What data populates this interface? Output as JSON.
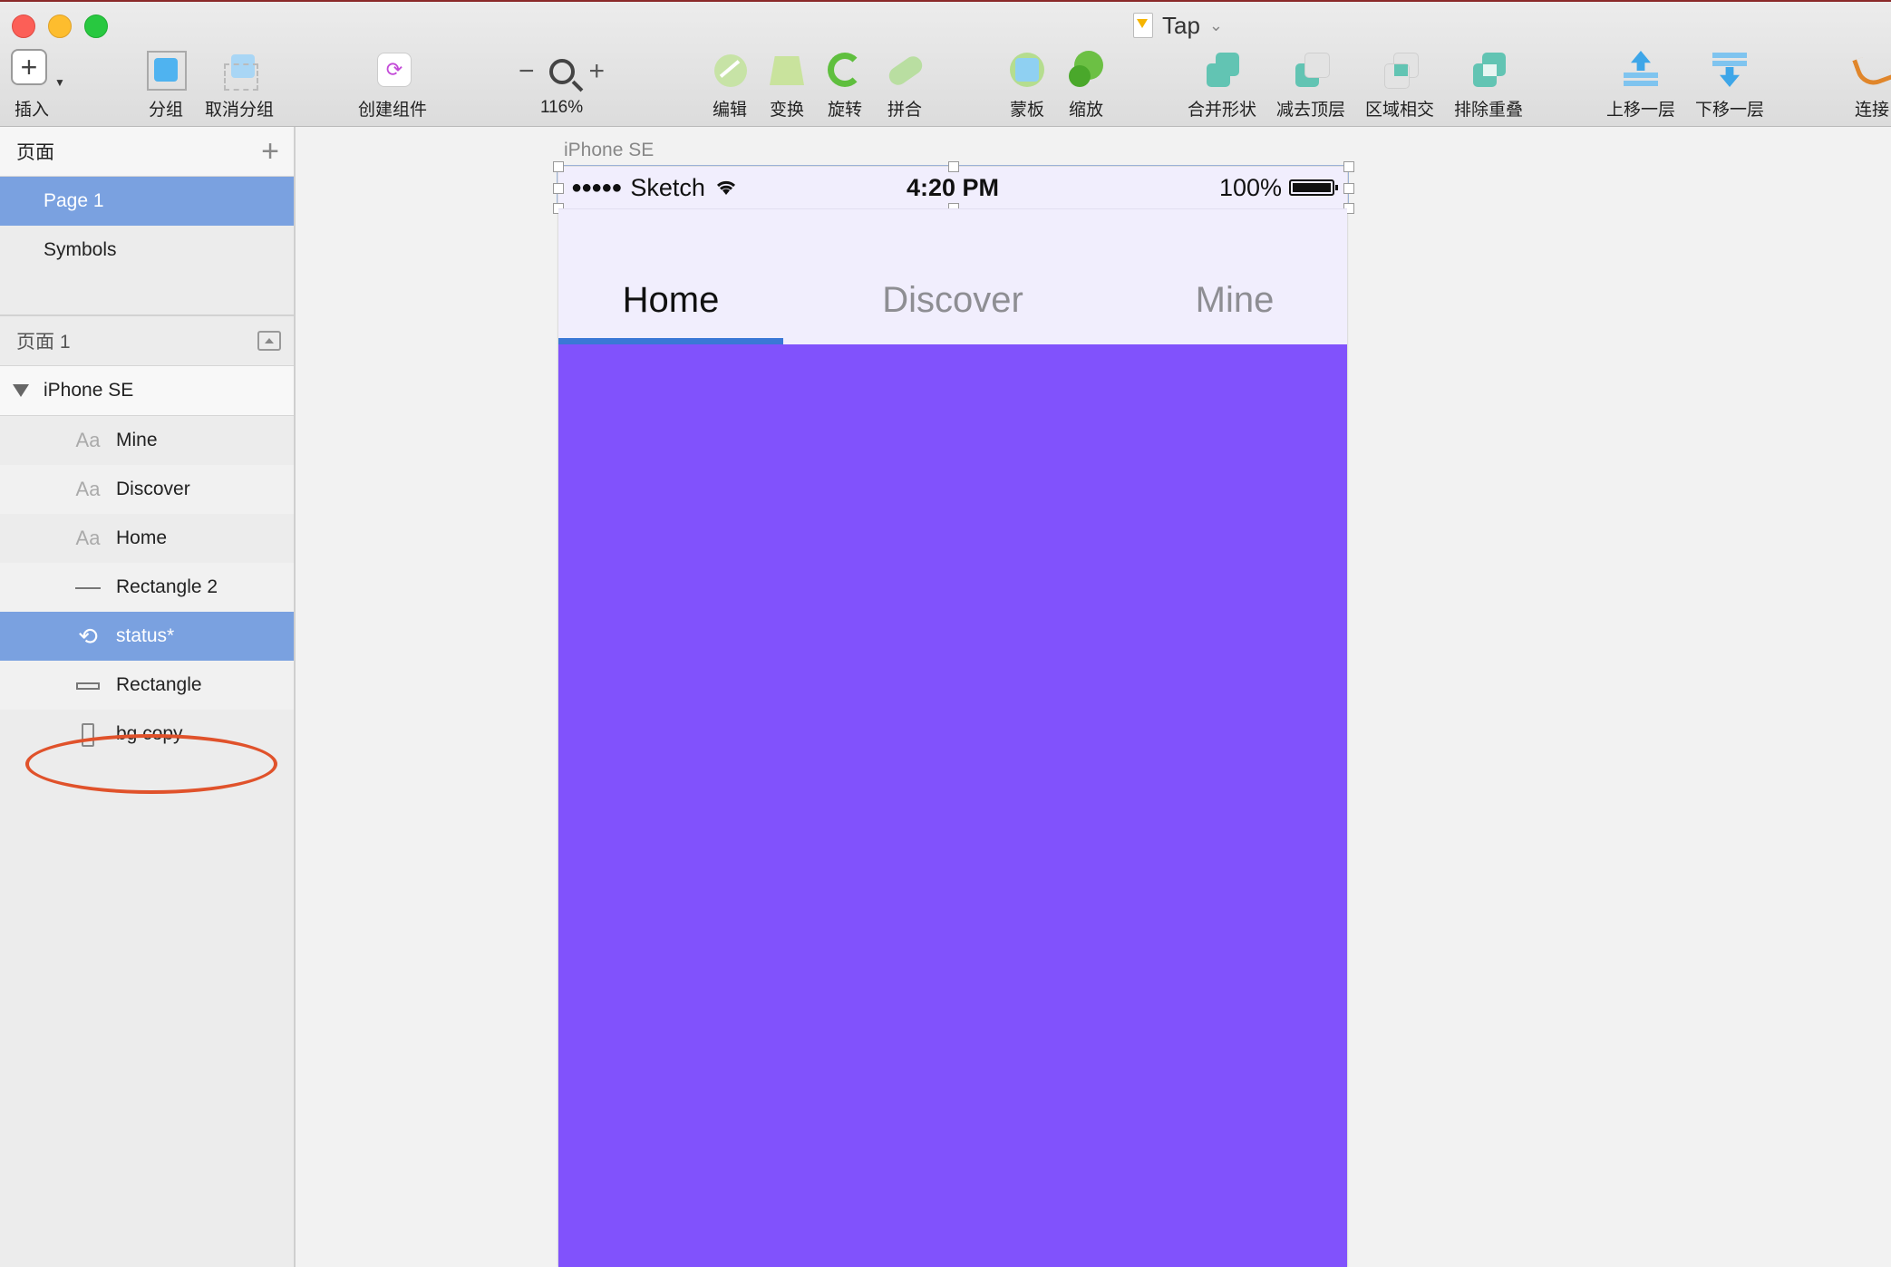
{
  "window": {
    "document_title": "Tap"
  },
  "toolbar": {
    "insert": "插入",
    "group": "分组",
    "ungroup": "取消分组",
    "create_symbol": "创建组件",
    "zoom_out": "−",
    "zoom_in": "+",
    "zoom_level": "116%",
    "edit": "编辑",
    "transform": "变换",
    "rotate": "旋转",
    "combine": "拼合",
    "mask": "蒙板",
    "scale": "缩放",
    "union": "合并形状",
    "subtract": "减去顶层",
    "intersect": "区域相交",
    "difference": "排除重叠",
    "forward": "上移一层",
    "backward": "下移一层",
    "link": "连接"
  },
  "sidebar": {
    "pages_title": "页面",
    "pages": [
      {
        "label": "Page 1",
        "selected": true
      },
      {
        "label": "Symbols",
        "selected": false
      }
    ],
    "layers_title": "页面 1",
    "artboard": "iPhone SE",
    "layers": [
      {
        "label": "Mine",
        "icon": "text-icon",
        "glyph": "Aa"
      },
      {
        "label": "Discover",
        "icon": "text-icon",
        "glyph": "Aa"
      },
      {
        "label": "Home",
        "icon": "text-icon",
        "glyph": "Aa"
      },
      {
        "label": "Rectangle 2",
        "icon": "line-icon"
      },
      {
        "label": "status*",
        "icon": "symbol-icon",
        "selected": true
      },
      {
        "label": "Rectangle",
        "icon": "rectangle-icon"
      },
      {
        "label": "bg copy",
        "icon": "artboard-icon"
      }
    ]
  },
  "canvas": {
    "artboard_label": "iPhone SE",
    "status_bar": {
      "signal": "●●●●●",
      "carrier": "Sketch",
      "time": "4:20 PM",
      "battery": "100%"
    },
    "tabs": [
      "Home",
      "Discover",
      "Mine"
    ],
    "active_tab": "Home",
    "colors": {
      "content": "#8152fc",
      "nav_background": "#f1eefd",
      "indicator": "#3a78d6",
      "selection": "#7aa1e0",
      "highlight_ring": "#e0522b"
    }
  }
}
